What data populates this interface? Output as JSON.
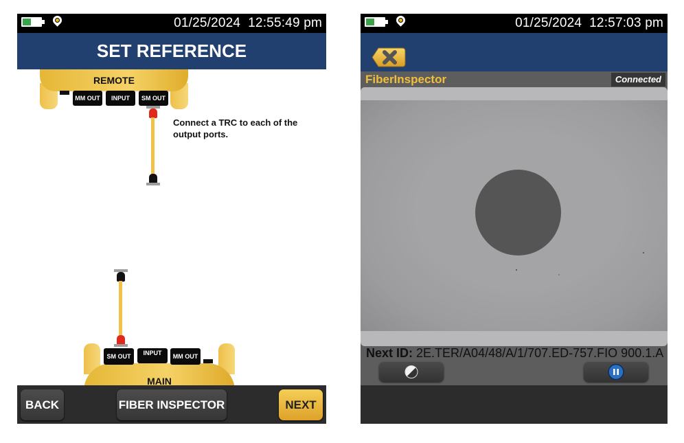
{
  "left_screen": {
    "status_bar": {
      "battery_icon": "battery-icon",
      "location_icon": "location-pin-icon",
      "datetime": "01/25/2024  12:55:49 pm"
    },
    "title": "SET REFERENCE",
    "remote_unit": {
      "label": "REMOTE",
      "ports": [
        "MM OUT",
        "INPUT",
        "SM OUT"
      ]
    },
    "instruction": "Connect a TRC to each of the output ports.",
    "main_unit": {
      "label": "MAIN",
      "ports": [
        "SM OUT",
        "INPUT",
        "MM OUT"
      ]
    },
    "buttons": {
      "back": "BACK",
      "fiber_inspector": "FIBER INSPECTOR",
      "next": "NEXT"
    },
    "colors": {
      "title_bar": "#22406f",
      "device_yellow": "#f0c24a",
      "next_button": "#e7b43b",
      "connector_red": "#e0281c"
    }
  },
  "right_screen": {
    "status_bar": {
      "battery_icon": "battery-icon",
      "location_icon": "location-pin-icon",
      "datetime": "01/25/2024  12:57:03 pm"
    },
    "close_icon": "close-x-icon",
    "app_name": "FiberInspector",
    "connection_status": "Connected",
    "next_id_label": "Next ID:",
    "next_id_value": "2E.TER/A04/48/A/1/707.ED-757.FIO 900.1.A",
    "controls": {
      "contrast_icon": "contrast-icon",
      "pause_icon": "pause-icon"
    },
    "colors": {
      "app_name": "#f2bf3a",
      "pause_button": "#2a6fc0"
    }
  }
}
